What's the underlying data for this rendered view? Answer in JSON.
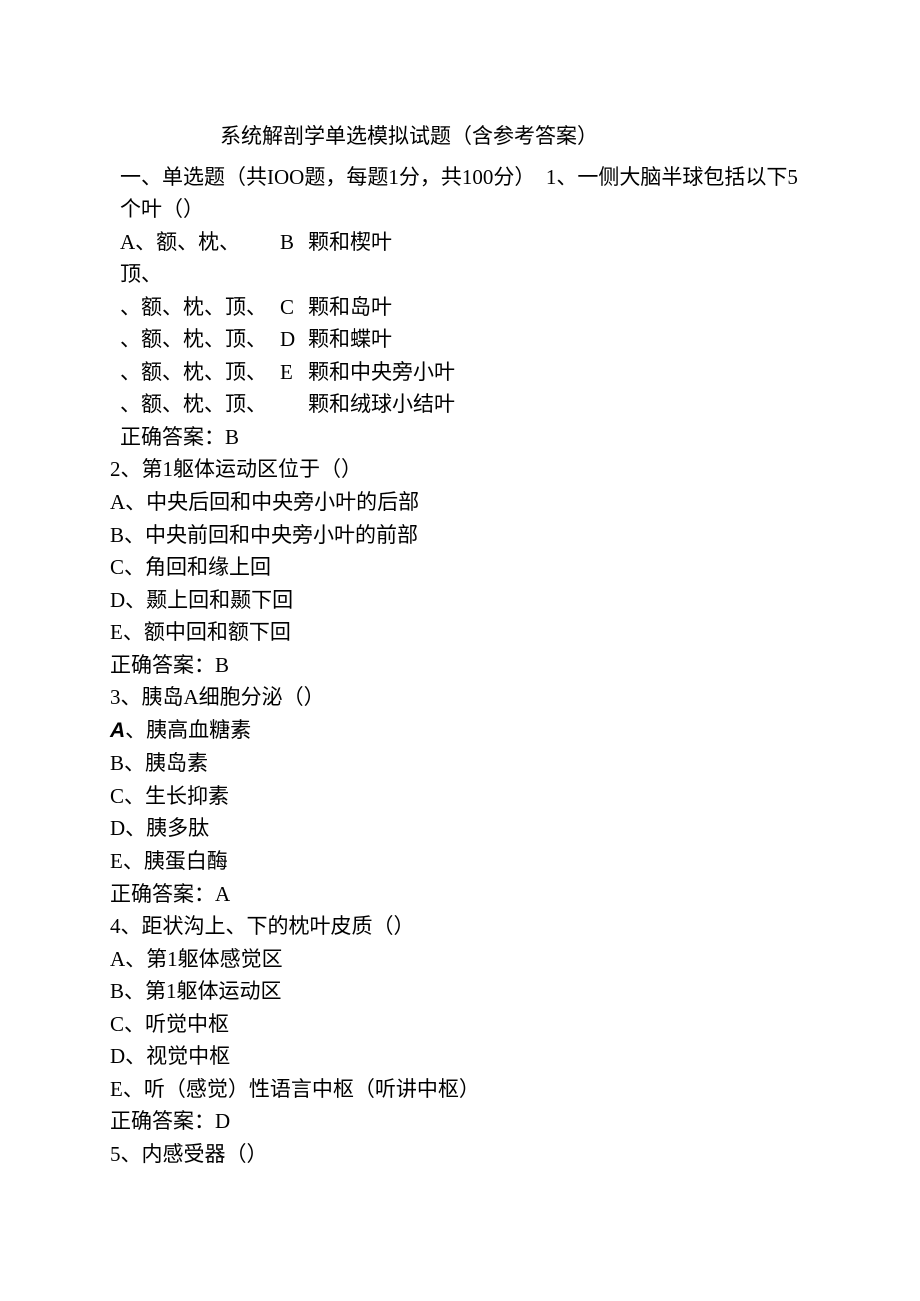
{
  "title": "系统解剖学单选模拟试题（含参考答案）",
  "section_header_prefix": "一、单选题（共",
  "section_mid1": "题，每题",
  "section_mid2": "分，共",
  "section_mid3": "分）",
  "count100_a": "IOO",
  "one": "1",
  "score100": "100",
  "q1": {
    "intro_tail": "1、一侧大脑半球包括以下5个叶（）",
    "rows": [
      {
        "left": "A、额、枕、顶、",
        "letter": "B",
        "right": "颗和楔叶"
      },
      {
        "left": "、额、枕、顶、",
        "letter": "C",
        "right": "颗和岛叶"
      },
      {
        "left": "、额、枕、顶、",
        "letter": "D",
        "right": "颗和蝶叶"
      },
      {
        "left": "、额、枕、顶、",
        "letter": "E",
        "right": "颗和中央旁小叶"
      },
      {
        "left": "、额、枕、顶、",
        "letter": "",
        "right": "颗和绒球小结叶"
      }
    ],
    "answer": "正确答案：B"
  },
  "q2": {
    "stem": "2、第1躯体运动区位于（）",
    "opts": [
      "A、中央后回和中央旁小叶的后部",
      "B、中央前回和中央旁小叶的前部",
      "C、角回和缘上回",
      "D、颞上回和颞下回",
      "E、额中回和额下回"
    ],
    "answer": "正确答案：B"
  },
  "q3": {
    "stem": "3、胰岛A细胞分泌（）",
    "opt_a_letter": "A",
    "opt_a_text": "、胰高血糖素",
    "opts_rest": [
      "B、胰岛素",
      "C、生长抑素",
      "D、胰多肽",
      "E、胰蛋白酶"
    ],
    "answer": "正确答案：A"
  },
  "q4": {
    "stem": "4、距状沟上、下的枕叶皮质（）",
    "opts": [
      "A、第1躯体感觉区",
      "B、第1躯体运动区",
      "C、听觉中枢",
      "D、视觉中枢",
      "E、听（感觉）性语言中枢（听讲中枢）"
    ],
    "answer": "正确答案：D"
  },
  "q5": {
    "stem": "5、内感受器（）"
  }
}
